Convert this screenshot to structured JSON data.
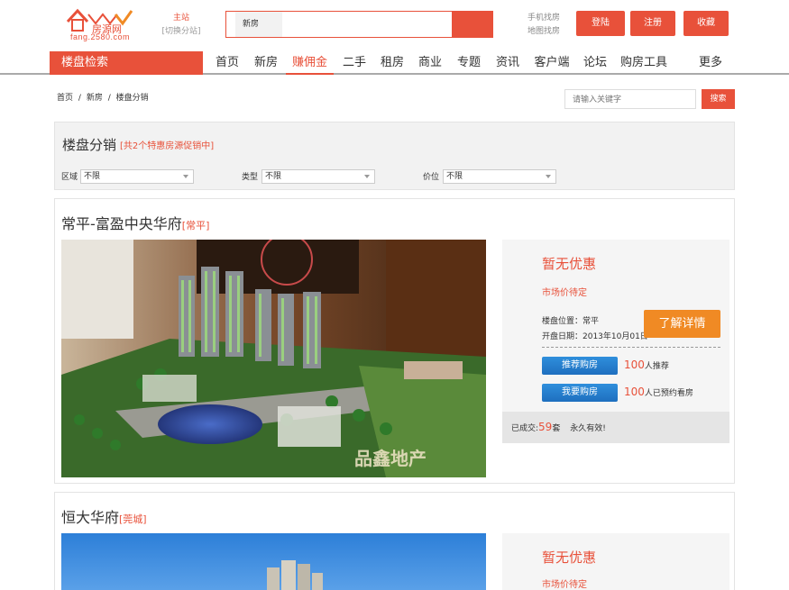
{
  "header": {
    "logo_text": "fang.2580.com",
    "site_main": "主站",
    "site_switch": "[切换分站]",
    "search_category": "新房",
    "quick_links": [
      "手机找房",
      "地图找房"
    ],
    "login": "登陆",
    "register": "注册",
    "favorite": "收藏"
  },
  "nav": {
    "title": "楼盘检索",
    "items": [
      "首页",
      "新房",
      "赚佣金",
      "二手",
      "租房",
      "商业",
      "专题",
      "资讯",
      "客户端",
      "论坛",
      "购房工具",
      "更多"
    ],
    "active": "赚佣金"
  },
  "breadcrumb": [
    "首页",
    "/",
    "新房",
    "/",
    "楼盘分销"
  ],
  "keyword_search": {
    "placeholder": "请输入关键字",
    "button": "搜索"
  },
  "filters": {
    "title": "楼盘分销",
    "count_text": "[共2个特惠房源促销中]",
    "groups": [
      {
        "label": "区域",
        "value": "不限"
      },
      {
        "label": "类型",
        "value": "不限"
      },
      {
        "label": "价位",
        "value": "不限"
      }
    ]
  },
  "listings": [
    {
      "name": "常平-富盈中央华府",
      "district": "[常平]",
      "deal": "暂无优惠",
      "price": "市场价待定",
      "location": "楼盘位置：常平",
      "open_date": "开盘日期：2013年10月01日",
      "detail_btn": "了解详情",
      "recommend_btn": "推荐购房",
      "recommend_num": "100",
      "recommend_suffix": "人推荐",
      "want_btn": "我要购房",
      "want_num": "100",
      "want_suffix": "人已预约看房",
      "deal_prefix": "已成交:",
      "deal_num": "59",
      "deal_unit": "套",
      "deal_note": "永久有效!",
      "image_watermark": "品鑫地产"
    },
    {
      "name": "恒大华府",
      "district": "[莞城]",
      "deal": "暂无优惠",
      "price": "市场价待定"
    }
  ],
  "colors": {
    "accent": "#e8513a",
    "orange": "#f08a24",
    "blue": "#2f8fdc"
  }
}
